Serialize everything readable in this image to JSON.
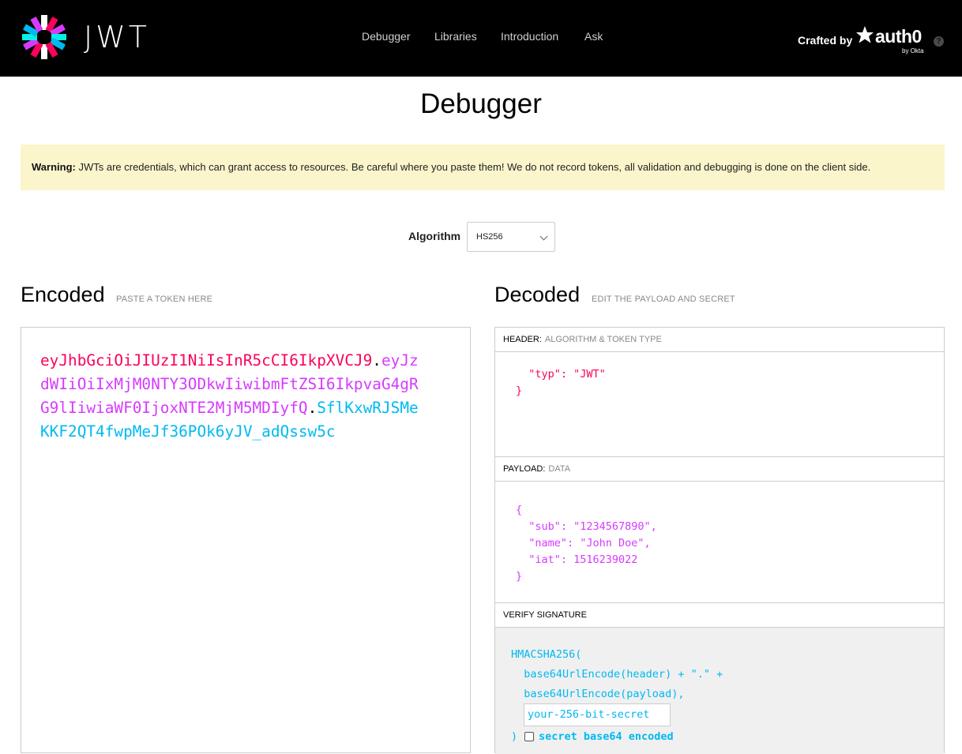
{
  "brand": {
    "word": "JWT"
  },
  "nav": {
    "debugger": "Debugger",
    "libraries": "Libraries",
    "introduction": "Introduction",
    "ask": "Ask"
  },
  "crafted": {
    "label": "Crafted by",
    "auth0": "auth0",
    "by": "by Okta",
    "help": "?"
  },
  "page": {
    "title": "Debugger"
  },
  "warning": {
    "bold": "Warning:",
    "text": " JWTs are credentials, which can grant access to resources. Be careful where you paste them! We do not record tokens, all validation and debugging is done on the client side."
  },
  "algorithm": {
    "label": "Algorithm",
    "selected": "HS256"
  },
  "encoded": {
    "title": "Encoded",
    "subtitle": "PASTE A TOKEN HERE",
    "token_header": "eyJhbGciOiJIUzI1NiIsInR5cCI6IkpXVCJ9",
    "dot1": ".",
    "token_payload": "eyJzdWIiOiIxMjM0NTY3ODkwIiwibmFtZSI6IkpvaG4gRG9lIiwiaWF0IjoxNTE2MjM5MDIyfQ",
    "dot2": ".",
    "token_signature": "SflKxwRJSMeKKF2QT4fwpMeJf36POk6yJV_adQssw5c"
  },
  "decoded": {
    "title": "Decoded",
    "subtitle": "EDIT THE PAYLOAD AND SECRET",
    "header_section": {
      "label": "HEADER:",
      "sub": "ALGORITHM & TOKEN TYPE",
      "code": "  \"typ\": \"JWT\"\n}"
    },
    "payload_section": {
      "label": "PAYLOAD:",
      "sub": "DATA",
      "code": "{\n  \"sub\": \"1234567890\",\n  \"name\": \"John Doe\",\n  \"iat\": 1516239022\n}"
    },
    "signature_section": {
      "label": "VERIFY SIGNATURE",
      "code": "HMACSHA256(\n  base64UrlEncode(header) + \".\" +\n  base64UrlEncode(payload),",
      "secret_value": "your-256-bit-secret",
      "close": ")",
      "checkbox_label": "secret base64 encoded"
    }
  },
  "colors": {
    "header": "#fb015b",
    "payload": "#d63aff",
    "signature": "#00b9f1",
    "warning_bg": "#fbf5cb"
  }
}
